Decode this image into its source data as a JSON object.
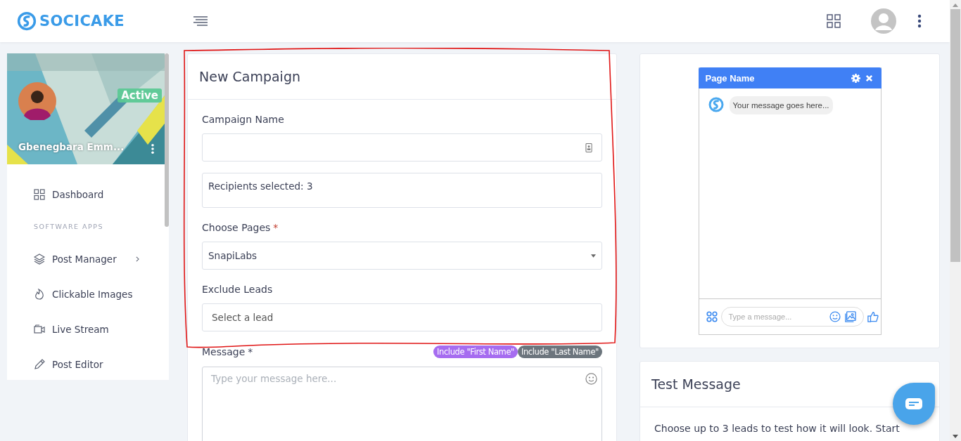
{
  "header": {
    "brand": "SOCICAKE"
  },
  "profile": {
    "name": "Gbenegbara Emm...",
    "status": "Active"
  },
  "sidebar": {
    "items": [
      {
        "kind": "link",
        "label": "Dashboard",
        "expandable": false
      },
      {
        "kind": "heading",
        "label": "SOFTWARE APPS"
      },
      {
        "kind": "link",
        "label": "Post Manager",
        "expandable": true
      },
      {
        "kind": "link",
        "label": "Clickable Images",
        "expandable": false
      },
      {
        "kind": "link",
        "label": "Live Stream",
        "expandable": false
      },
      {
        "kind": "link",
        "label": "Post Editor",
        "expandable": false
      }
    ]
  },
  "campaign": {
    "title": "New Campaign",
    "fields": [
      {
        "kind": "input",
        "label": "Campaign Name"
      },
      {
        "kind": "info",
        "value": "Recipients selected: 3"
      },
      {
        "kind": "select",
        "label": "Choose Pages",
        "required_mark": "*",
        "value": "SnapiLabs"
      },
      {
        "kind": "input",
        "label": "Exclude Leads",
        "placeholder": "Select a lead"
      }
    ],
    "message": {
      "label": "Message",
      "required_mark": "*",
      "placeholder": "Type your message here...",
      "tags": [
        {
          "label": "Include \"First Name\"",
          "color": "#a66cf0"
        },
        {
          "label": "Include \"Last Name\"",
          "color": "#6c757d"
        }
      ]
    }
  },
  "preview": {
    "page_name": "Page Name",
    "bubble": "Your message goes here...",
    "input_placeholder": "Type a message..."
  },
  "test_message": {
    "title": "Test Message",
    "text": "Choose up to 3 leads to test how it will look. Start"
  }
}
